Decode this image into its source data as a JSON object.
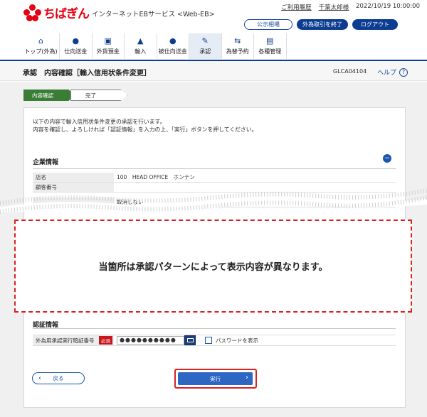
{
  "header": {
    "brand": "ちばぎん",
    "service_name": "インターネットEBサービス <Web-EB>",
    "usage_history_link": "ご利用履歴",
    "user_name": "千葉太郎様",
    "datetime": "2022/10/19 10:00:00",
    "rate_button": "公示相場",
    "fx_end_button": "外為取引を終了",
    "logout_button": "ログアウト"
  },
  "nav": [
    {
      "label": "トップ(外為)",
      "icon": "home-icon"
    },
    {
      "label": "仕向送金",
      "icon": "remit-icon"
    },
    {
      "label": "外貨預金",
      "icon": "deposit-icon"
    },
    {
      "label": "輸入",
      "icon": "import-icon"
    },
    {
      "label": "被仕向送金",
      "icon": "receive-icon"
    },
    {
      "label": "承認",
      "icon": "approve-icon",
      "active": true
    },
    {
      "label": "為替予約",
      "icon": "forex-icon"
    },
    {
      "label": "各種管理",
      "icon": "settings-icon"
    }
  ],
  "title": {
    "section": "承認",
    "page": "内容確認［輸入信用状条件変更］",
    "code": "GLCA04104",
    "help": "ヘルプ"
  },
  "steps": [
    "内容確認",
    "完了"
  ],
  "intro": {
    "line1": "以下の内容で輸入信用状条件変更の承認を行います。",
    "line2": "内容を確認し、よろしければ「認証情報」を入力の上、「実行」ボタンを押してください。"
  },
  "company": {
    "title": "企業情報",
    "rows": [
      {
        "label": "店名",
        "value": "100　HEAD OFFICE　ホンテン"
      },
      {
        "label": "顧客番号",
        "value": ""
      },
      {
        "label": "",
        "value": "取消しない"
      }
    ]
  },
  "note": "当箇所は承認パターンによって表示内容が異なります。",
  "auth": {
    "title": "認証情報",
    "field_label": "外為用承認実行暗証番号",
    "required": "必須",
    "password_mask": "●●●●●●●●●●",
    "show_password_label": "パスワードを表示"
  },
  "buttons": {
    "back": "戻る",
    "execute": "実行"
  },
  "colors": {
    "brand_red": "#e60012",
    "primary_blue": "#0d3d91",
    "step_green": "#3a7d35"
  }
}
